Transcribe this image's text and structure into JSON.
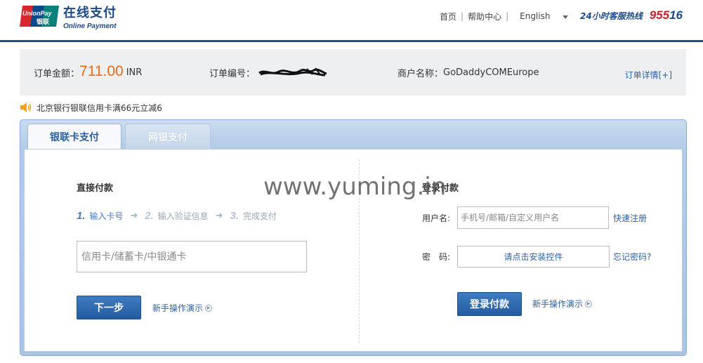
{
  "brand": {
    "logo_text_top": "UnionPay",
    "logo_text_bottom": "银联",
    "title_cn": "在线支付",
    "title_en": "Online Payment",
    "colors": {
      "primary": "#1c4a88",
      "red": "#c8202a",
      "accent_orange": "#ee6a16",
      "link": "#2b62a8"
    }
  },
  "topnav": {
    "home": "首页",
    "help": "帮助中心",
    "language": "English",
    "hotline_label": "24小时客服热线",
    "hotline_prefix": "955",
    "hotline_suffix": "16"
  },
  "order": {
    "amount_label": "订单金额：",
    "amount_value": "711.00",
    "currency": "INR",
    "number_label": "订单编号：",
    "merchant_label": "商户名称：",
    "merchant_name": "GoDaddyCOMEurope",
    "details_link": "订单详情[+]"
  },
  "promo": {
    "icon": "speaker-icon",
    "text": "北京银行银联信用卡满66元立减6"
  },
  "tabs": [
    {
      "label": "银联卡支付",
      "active": true
    },
    {
      "label": "网银支付",
      "active": false
    }
  ],
  "direct_pay": {
    "title": "直接付款",
    "steps": [
      {
        "num": "1.",
        "label": "输入卡号"
      },
      {
        "num": "2.",
        "label": "输入验证信息"
      },
      {
        "num": "3.",
        "label": "完成支付"
      }
    ],
    "card_placeholder": "信用卡/储蓄卡/中银通卡",
    "next_button": "下一步",
    "demo_link": "新手操作演示"
  },
  "login_pay": {
    "title": "登录付款",
    "username_label": "用户名:",
    "username_placeholder": "手机号/邮箱/自定义用户名",
    "register_link": "快速注册",
    "password_label": "密　码:",
    "install_control": "请点击安装控件",
    "forgot_link": "忘记密码?",
    "login_button": "登录付款",
    "demo_link": "新手操作演示"
  },
  "watermark": "www.yuming.in"
}
